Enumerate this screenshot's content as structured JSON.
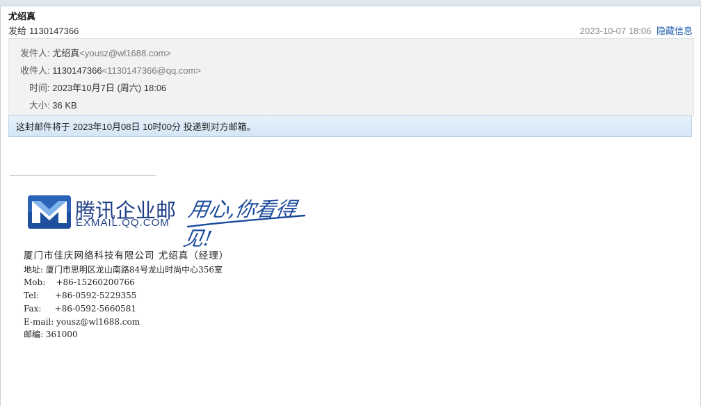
{
  "header": {
    "sender_name": "尤绍真",
    "to_prefix": "发给",
    "to_value": "1130147366",
    "datetime": "2023-10-07 18:06",
    "hide_info_label": "隐藏信息"
  },
  "meta": {
    "from_label": "发件人:",
    "from_name": "尤绍真",
    "from_email": "<yousz@wl1688.com>",
    "to_label": "收件人:",
    "to_name": "1130147366",
    "to_email": "<1130147366@qq.com>",
    "time_label": "时间:",
    "time_value": "2023年10月7日 (周六) 18:06",
    "size_label": "大小:",
    "size_value": "36 KB"
  },
  "notice": {
    "text": "这封邮件将于 2023年10月08日 10时00分 投递到对方邮箱。"
  },
  "logo": {
    "brand_cn": "腾讯企业邮",
    "brand_en": "EXMAIL.QQ.COM",
    "slogan": "用心,你看得见!",
    "brand_color": "#1f3f86",
    "icon": "tencent-exmail-logo-icon"
  },
  "signature": {
    "company_line": "厦门市佳庆网络科技有限公司 尤绍真（经理）",
    "address": "地址: 厦门市思明区龙山南路84号龙山时尚中心356室",
    "mob": "Mob:    +86-15260200766",
    "tel": "Tel:      +86-0592-5229355",
    "fax": "Fax:     +86-0592-5660581",
    "email": "E-mail: yousz@wl1688.com",
    "zip": "邮编: 361000"
  }
}
